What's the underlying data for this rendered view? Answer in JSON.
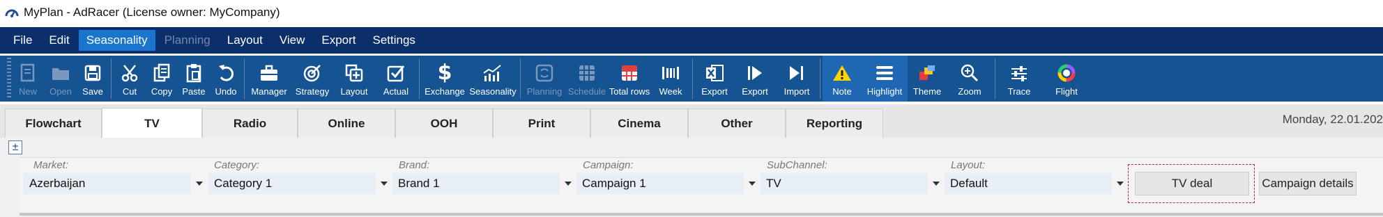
{
  "window": {
    "title": "MyPlan - AdRacer (License owner: MyCompany)"
  },
  "menu": {
    "items": [
      {
        "label": "File",
        "state": "normal"
      },
      {
        "label": "Edit",
        "state": "normal"
      },
      {
        "label": "Seasonality",
        "state": "active"
      },
      {
        "label": "Planning",
        "state": "disabled"
      },
      {
        "label": "Layout",
        "state": "normal"
      },
      {
        "label": "View",
        "state": "normal"
      },
      {
        "label": "Export",
        "state": "normal"
      },
      {
        "label": "Settings",
        "state": "normal"
      }
    ]
  },
  "toolbar": {
    "groups": [
      [
        {
          "label": "New",
          "icon": "new-document-icon",
          "disabled": true
        },
        {
          "label": "Open",
          "icon": "folder-icon",
          "disabled": true
        },
        {
          "label": "Save",
          "icon": "save-icon",
          "disabled": false
        }
      ],
      [
        {
          "label": "Cut",
          "icon": "scissors-icon",
          "disabled": false
        },
        {
          "label": "Copy",
          "icon": "copy-icon",
          "disabled": false
        },
        {
          "label": "Paste",
          "icon": "clipboard-icon",
          "disabled": false
        },
        {
          "label": "Undo",
          "icon": "undo-icon",
          "disabled": false
        }
      ],
      [
        {
          "label": "Manager",
          "icon": "briefcase-icon",
          "disabled": false
        },
        {
          "label": "Strategy",
          "icon": "target-icon",
          "disabled": false
        },
        {
          "label": "Layout",
          "icon": "layout-add-icon",
          "disabled": false
        },
        {
          "label": "Actual",
          "icon": "checkbox-icon",
          "disabled": false
        }
      ],
      [
        {
          "label": "Exchange",
          "icon": "dollar-icon",
          "disabled": false
        },
        {
          "label": "Seasonality",
          "icon": "chart-icon",
          "disabled": false
        }
      ],
      [
        {
          "label": "Planning",
          "icon": "planning-icon",
          "disabled": true
        },
        {
          "label": "Schedule",
          "icon": "schedule-grid-icon",
          "disabled": true
        },
        {
          "label": "Total rows",
          "icon": "total-rows-icon",
          "disabled": false
        },
        {
          "label": "Week",
          "icon": "week-icon",
          "disabled": false
        }
      ],
      [
        {
          "label": "Export",
          "icon": "excel-icon",
          "disabled": false
        },
        {
          "label": "Export",
          "icon": "play-export-icon",
          "disabled": false
        },
        {
          "label": "Import",
          "icon": "import-icon",
          "disabled": false
        }
      ],
      [
        {
          "label": "Note",
          "icon": "warning-icon",
          "disabled": false,
          "pressed": true
        },
        {
          "label": "Highlight",
          "icon": "highlight-icon",
          "disabled": false,
          "pressed": true
        },
        {
          "label": "Theme",
          "icon": "palette-icon",
          "disabled": false
        },
        {
          "label": "Zoom",
          "icon": "zoom-icon",
          "disabled": false
        }
      ],
      [
        {
          "label": "Trace",
          "icon": "sliders-icon",
          "disabled": false
        },
        {
          "label": "Flight",
          "icon": "color-wheel-icon",
          "disabled": false
        }
      ]
    ]
  },
  "tabs": [
    {
      "label": "Flowchart",
      "active": false
    },
    {
      "label": "TV",
      "active": true
    },
    {
      "label": "Radio",
      "active": false
    },
    {
      "label": "Online",
      "active": false
    },
    {
      "label": "OOH",
      "active": false
    },
    {
      "label": "Print",
      "active": false
    },
    {
      "label": "Cinema",
      "active": false
    },
    {
      "label": "Other",
      "active": false
    },
    {
      "label": "Reporting",
      "active": false
    }
  ],
  "date_text": "Monday, 22.01.202",
  "expand_toggle": "±",
  "filters": [
    {
      "label": "Market:",
      "value": "Azerbaijan"
    },
    {
      "label": "Category:",
      "value": "Category 1"
    },
    {
      "label": "Brand:",
      "value": "Brand 1"
    },
    {
      "label": "Campaign:",
      "value": "Campaign 1"
    },
    {
      "label": "SubChannel:",
      "value": "TV"
    },
    {
      "label": "Layout:",
      "value": "Default"
    }
  ],
  "buttons": {
    "tv_deal": "TV deal",
    "campaign_details": "Campaign details"
  },
  "colors": {
    "menubar": "#0b2f6b",
    "toolbar": "#165392",
    "menu_active": "#1a75cf",
    "deal_outline": "#cc2222"
  }
}
